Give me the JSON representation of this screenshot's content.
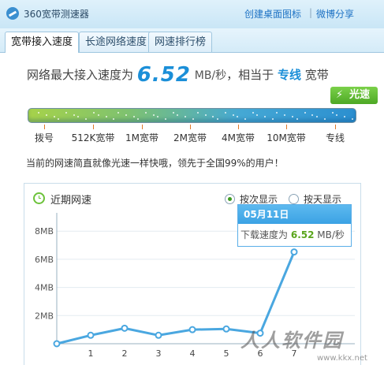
{
  "app": {
    "title": "360宽带测速器"
  },
  "header_links": {
    "create_shortcut": "创建桌面图标",
    "separator": "|",
    "weibo_share": "微博分享"
  },
  "tabs": [
    {
      "label": "宽带接入速度",
      "active": true
    },
    {
      "label": "长途网络速度",
      "active": false
    },
    {
      "label": "网速排行榜",
      "active": false
    }
  ],
  "result": {
    "prefix": "网络最大接入速度为",
    "speed": "6.52",
    "unit": "MB/秒",
    "middle": "，相当于",
    "type": "专线",
    "suffix": "宽带",
    "badge_label": "光速",
    "badge_icon": "lightning-icon"
  },
  "speed_scale": [
    "拨号",
    "512K宽带",
    "1M宽带",
    "2M宽带",
    "4M宽带",
    "10M宽带",
    "专线"
  ],
  "message": "当前的网速简直就像光速一样快哦，领先于全国99%的用户！",
  "chart_panel": {
    "title": "近期网速",
    "title_icon": "clock-icon",
    "radio_options": [
      {
        "label": "按次显示",
        "checked": true
      },
      {
        "label": "按天显示",
        "checked": false
      }
    ]
  },
  "tooltip": {
    "date": "05月11日",
    "label": "下载速度为",
    "value": "6.52",
    "unit": "MB/秒"
  },
  "chart_data": {
    "type": "line",
    "x": [
      0,
      1,
      2,
      3,
      4,
      5,
      6,
      7
    ],
    "xticks": [
      "1",
      "2",
      "3",
      "4",
      "5",
      "6",
      "7"
    ],
    "values": [
      0,
      0.6,
      1.1,
      0.6,
      1.0,
      1.05,
      0.75,
      6.52
    ],
    "yticks": [
      "2MB",
      "4MB",
      "6MB",
      "8MB"
    ],
    "yticks_values": [
      2,
      4,
      6,
      8
    ],
    "ylim": [
      0,
      9
    ],
    "grid": "horizontal",
    "color": "#4aa7e0"
  },
  "watermark": {
    "logo": "人人软件园",
    "url": "www.kkx.net"
  }
}
